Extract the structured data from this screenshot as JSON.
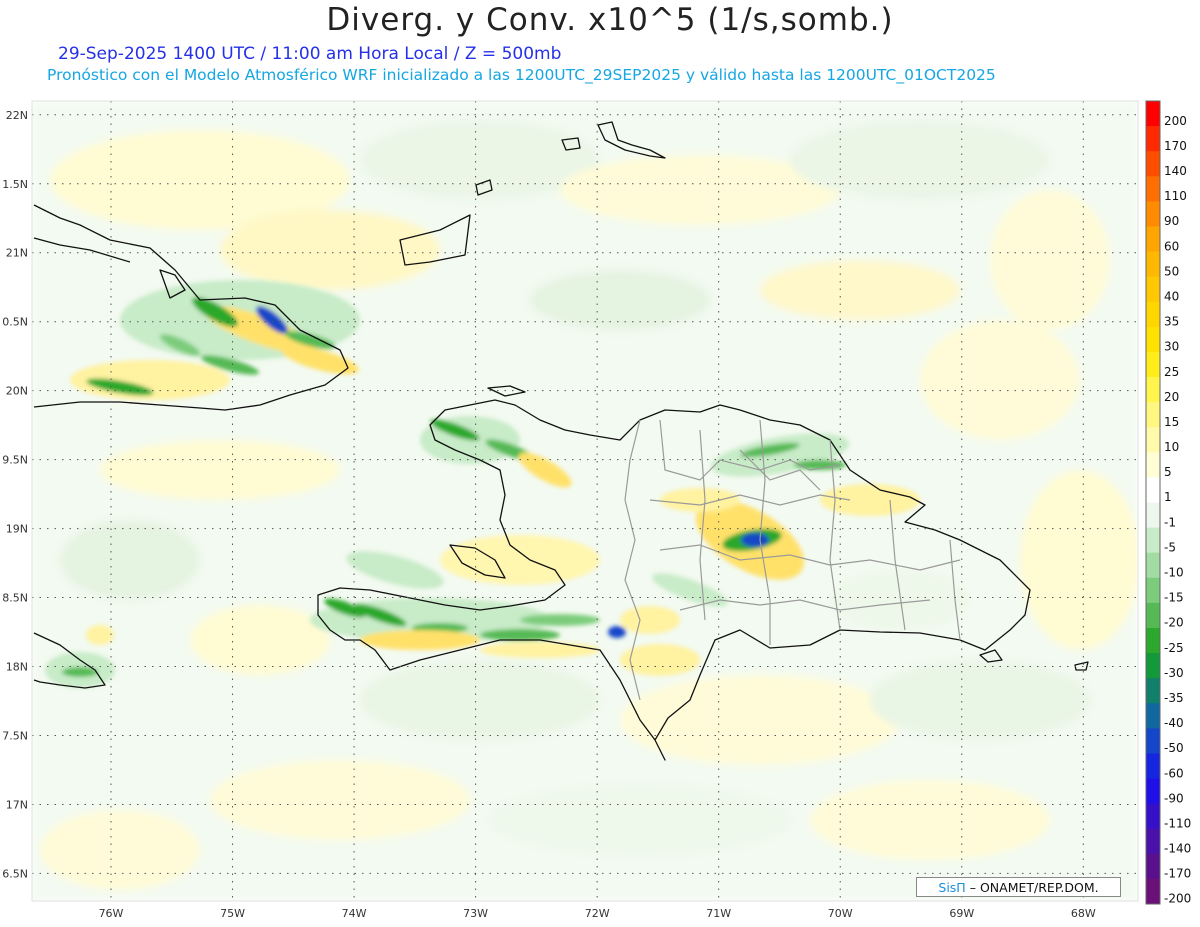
{
  "header": {
    "title": "Diverg. y Conv. x10^5 (1/s,somb.)",
    "subtitle": "29-Sep-2025 1400 UTC / 11:00 am Hora Local / Z = 500mb",
    "forecast_note": "Pronóstico con el Modelo Atmosférico WRF inicializado a las 1200UTC_29SEP2025 y válido hasta las  1200UTC_01OCT2025"
  },
  "map": {
    "region": "La Española y Cuba oriental",
    "lon_range": [
      -76.65,
      -67.55
    ],
    "lat_range": [
      16.3,
      22.1
    ],
    "lat_labels": [
      {
        "lat": 22,
        "text": "22N"
      },
      {
        "lat": 21.5,
        "text": "1.5N"
      },
      {
        "lat": 21,
        "text": "21N"
      },
      {
        "lat": 20.5,
        "text": "0.5N"
      },
      {
        "lat": 20,
        "text": "20N"
      },
      {
        "lat": 19.5,
        "text": "9.5N"
      },
      {
        "lat": 19,
        "text": "19N"
      },
      {
        "lat": 18.5,
        "text": "8.5N"
      },
      {
        "lat": 18,
        "text": "18N"
      },
      {
        "lat": 17.5,
        "text": "7.5N"
      },
      {
        "lat": 17,
        "text": "17N"
      },
      {
        "lat": 16.5,
        "text": "6.5N"
      }
    ],
    "lon_labels": [
      {
        "lon": -76,
        "text": "76W"
      },
      {
        "lon": -75,
        "text": "75W"
      },
      {
        "lon": -74,
        "text": "74W"
      },
      {
        "lon": -73,
        "text": "73W"
      },
      {
        "lon": -72,
        "text": "72W"
      },
      {
        "lon": -71,
        "text": "71W"
      },
      {
        "lon": -70,
        "text": "70W"
      },
      {
        "lon": -69,
        "text": "69W"
      },
      {
        "lon": -68,
        "text": "68W"
      }
    ],
    "colors": {
      "land_outline": "#111111",
      "province_lines": "#9a9a9a",
      "grid": "#555555"
    }
  },
  "colorbar": {
    "labels": [
      "200",
      "170",
      "140",
      "110",
      "90",
      "60",
      "50",
      "40",
      "35",
      "30",
      "25",
      "20",
      "15",
      "10",
      "5",
      "1",
      "-1",
      "-5",
      "-10",
      "-15",
      "-20",
      "-25",
      "-30",
      "-35",
      "-40",
      "-50",
      "-60",
      "-90",
      "-110",
      "-140",
      "-170",
      "-200"
    ],
    "colors": [
      "#ff0000",
      "#ff2a00",
      "#ff4d00",
      "#ff6e00",
      "#ff8c00",
      "#ffa500",
      "#ffb800",
      "#ffc800",
      "#ffd600",
      "#ffe200",
      "#ffed1a",
      "#fff54d",
      "#fff880",
      "#fffbab",
      "#fffdd6",
      "#ffffff",
      "#eef7ee",
      "#c8ebc8",
      "#a3dca3",
      "#7ccc7c",
      "#55ba55",
      "#2ca82c",
      "#129a3a",
      "#10806a",
      "#1168a0",
      "#1346c8",
      "#1626e0",
      "#1e10e6",
      "#3510c8",
      "#4a10aa",
      "#5a108c",
      "#6a1078"
    ]
  },
  "credit": {
    "brand": "SisΠ",
    "separator": "–",
    "org": "ONAMET/REP.DOM."
  }
}
